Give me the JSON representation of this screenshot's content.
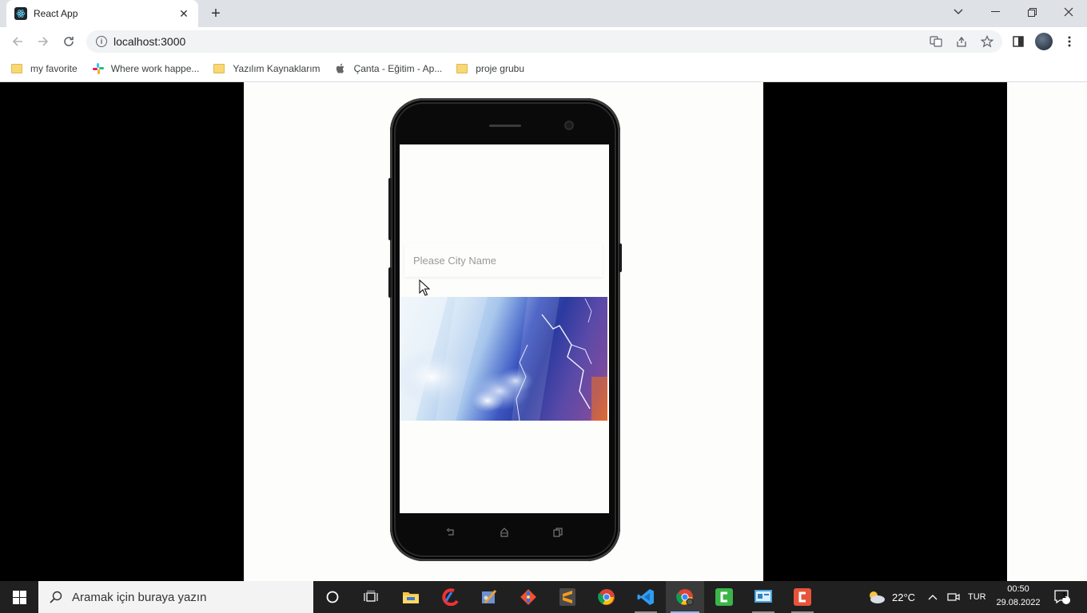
{
  "browser": {
    "tab_title": "React App",
    "url": "localhost:3000",
    "bookmarks": [
      {
        "label": "my favorite",
        "icon": "folder-icon"
      },
      {
        "label": "Where work happe...",
        "icon": "slack-icon"
      },
      {
        "label": "Yazılım Kaynaklarım",
        "icon": "folder-icon"
      },
      {
        "label": "Çanta - Eğitim - Ap...",
        "icon": "apple-icon"
      },
      {
        "label": "proje grubu",
        "icon": "folder-icon"
      }
    ]
  },
  "app": {
    "city_input_placeholder": "Please City Name"
  },
  "taskbar": {
    "search_placeholder": "Aramak için buraya yazın",
    "weather_temp": "22°C",
    "language": "TUR",
    "time": "00:50",
    "date": "29.08.2022",
    "notifications": "1"
  },
  "colors": {
    "tabstrip": "#dee1e6",
    "taskbar": "#202020",
    "page_bg": "#fdfdfb"
  }
}
